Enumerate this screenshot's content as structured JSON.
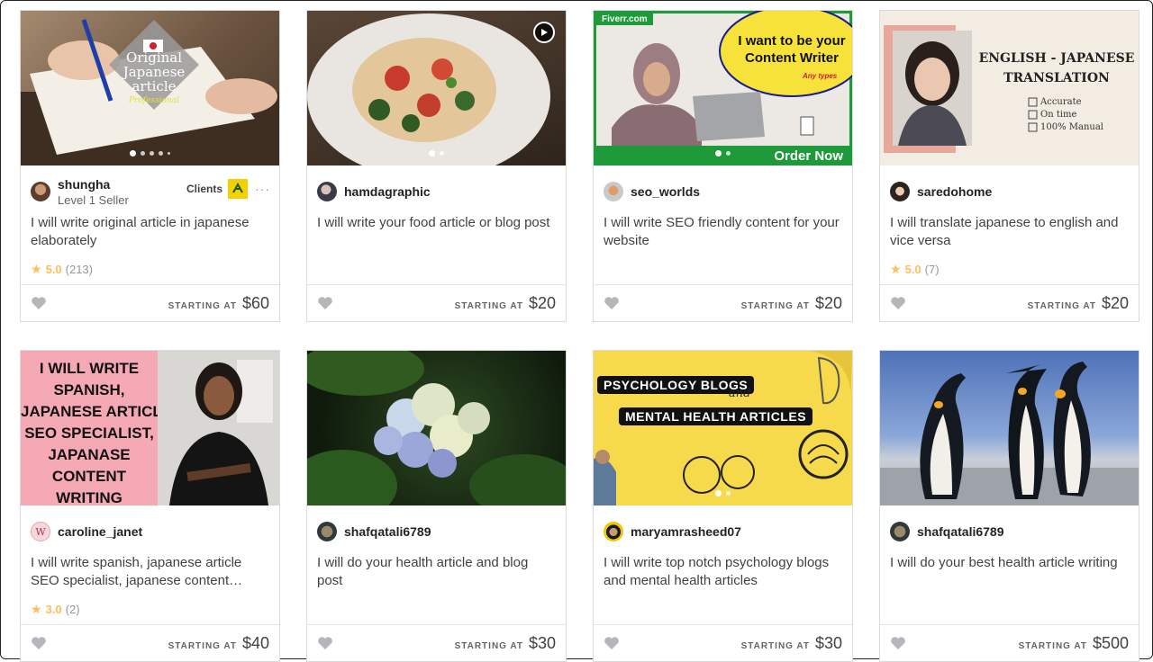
{
  "gigs": [
    {
      "seller": "shungha",
      "level": "Level 1 Seller",
      "clients_label": "Clients",
      "title": "I will write original article in japanese elaborately",
      "rating": "5.0",
      "reviews": "(213)",
      "starting_label": "STARTING AT",
      "price": "$60",
      "thumb": {
        "line1": "Original",
        "line2": "Japanese",
        "line3": "article",
        "badge": "Professional"
      }
    },
    {
      "seller": "hamdagraphic",
      "title": "I will write your food article or blog post",
      "starting_label": "STARTING AT",
      "price": "$20"
    },
    {
      "seller": "seo_worlds",
      "title": "I will write SEO friendly content for your website",
      "starting_label": "STARTING AT",
      "price": "$20",
      "thumb": {
        "brand": "Fiverr.com",
        "headline1": "I want to be your",
        "headline2": "Content Writer",
        "sub": "Any types",
        "cta": "Order Now"
      }
    },
    {
      "seller": "saredohome",
      "title": "I will translate japanese to english and vice versa",
      "rating": "5.0",
      "reviews": "(7)",
      "starting_label": "STARTING AT",
      "price": "$20",
      "thumb": {
        "heading1": "ENGLISH - JAPANESE",
        "heading2": "TRANSLATION",
        "check1": "Accurate",
        "check2": "On time",
        "check3": "100% Manual"
      }
    },
    {
      "seller": "caroline_janet",
      "avatar_letter": "W",
      "title": "I will write spanish, japanese article SEO specialist, japanese content…",
      "rating": "3.0",
      "reviews": "(2)",
      "starting_label": "STARTING AT",
      "price": "$40",
      "thumb": {
        "lines": [
          "I WILL WRITE",
          "SPANISH,",
          "JAPANESE ARTICLE",
          "SEO SPECIALIST,",
          "JAPANASE",
          "CONTENT",
          "WRITING"
        ]
      }
    },
    {
      "seller": "shafqatali6789",
      "title": "I will do your health article and blog post",
      "starting_label": "STARTING AT",
      "price": "$30"
    },
    {
      "seller": "maryamrasheed07",
      "title": "I will write top notch psychology blogs and mental health articles",
      "starting_label": "STARTING AT",
      "price": "$30",
      "thumb": {
        "tag1": "PSYCHOLOGY BLOGS",
        "and": "and",
        "tag2": "MENTAL HEALTH ARTICLES"
      }
    },
    {
      "seller": "shafqatali6789",
      "title": "I will do your best health article writing",
      "starting_label": "STARTING AT",
      "price": "$500"
    }
  ],
  "colors": {
    "star": "#ffbe5b",
    "heart": "#b5b6ba",
    "fiverr_green": "#1dbf73",
    "yellow": "#f7d94c",
    "pink": "#f4a9b5"
  }
}
